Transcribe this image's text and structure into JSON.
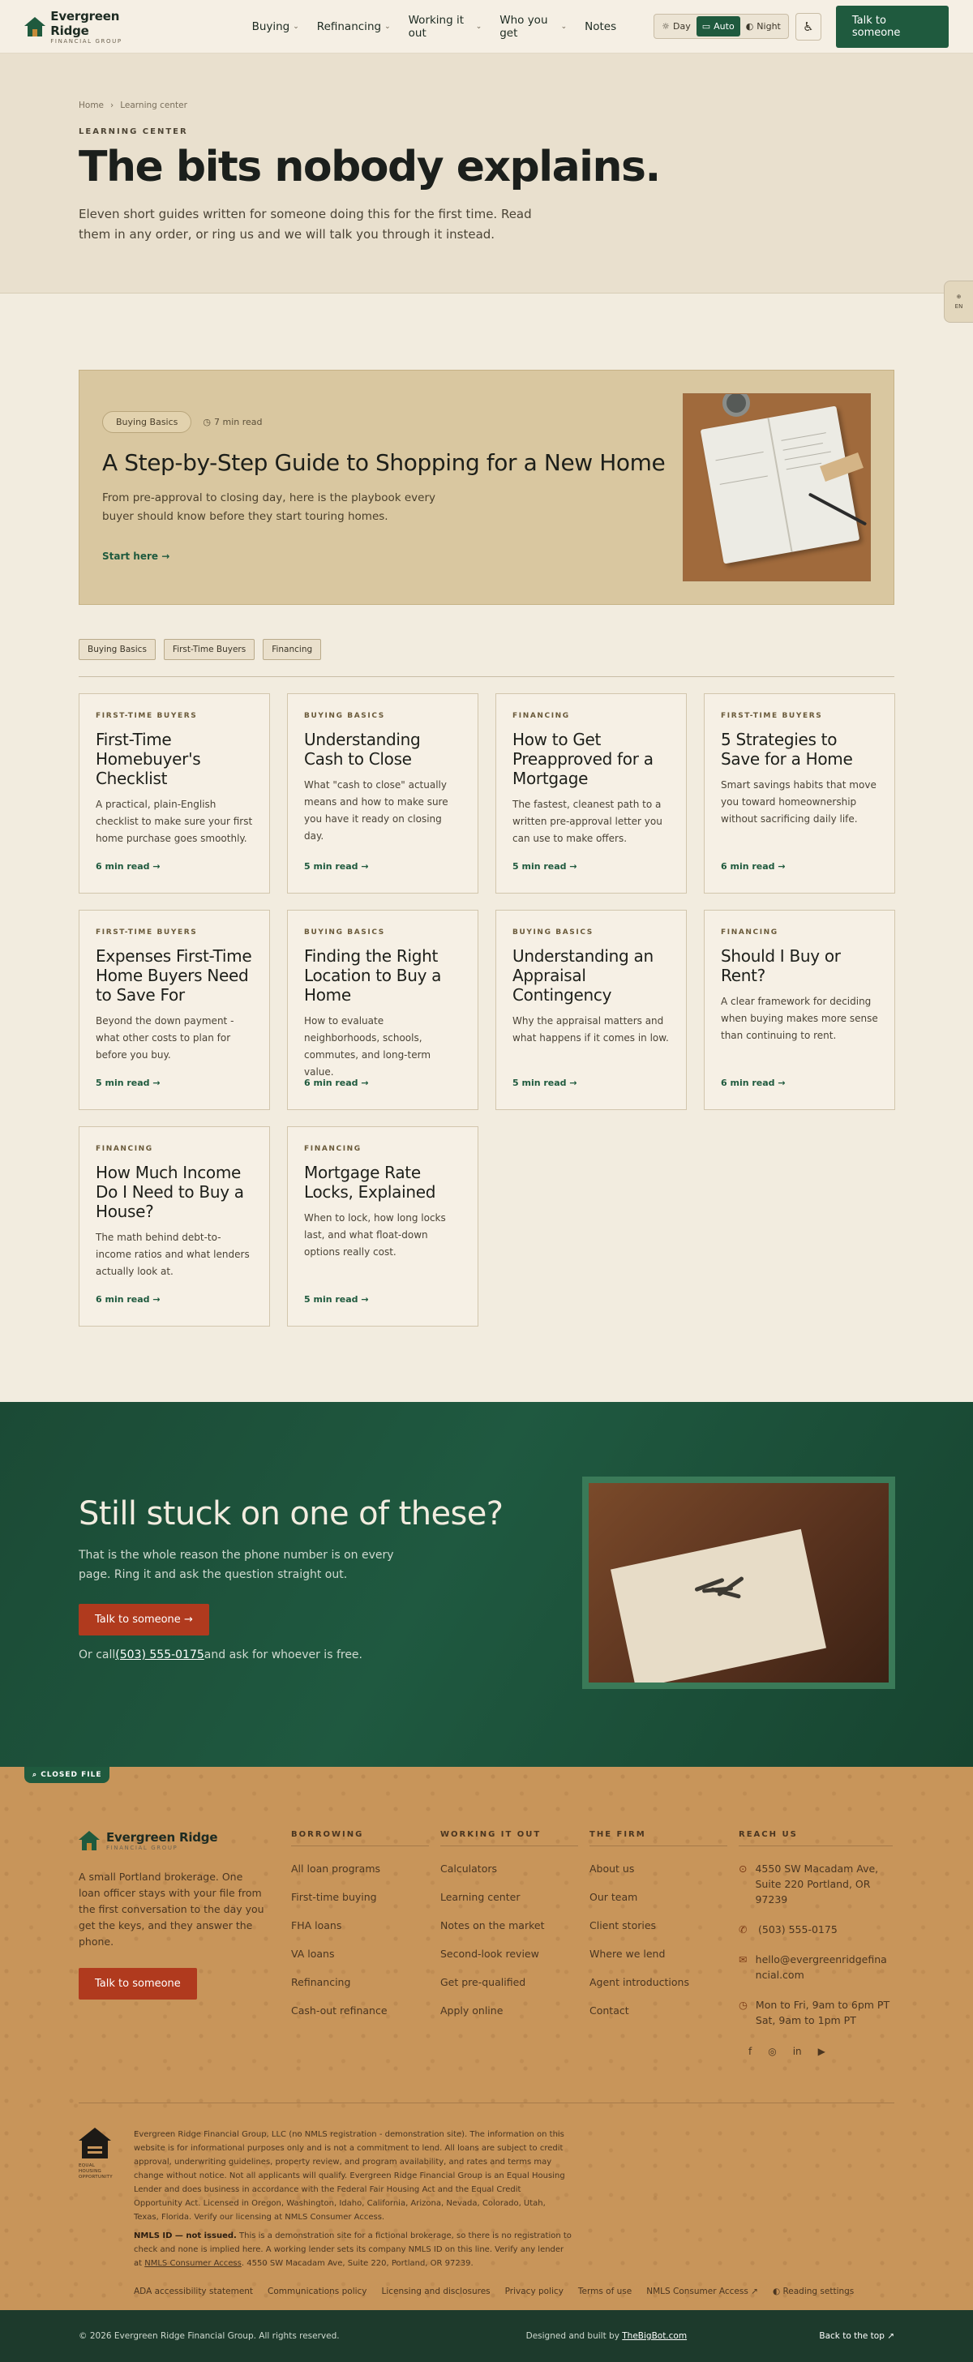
{
  "header": {
    "brand_name": "Evergreen Ridge",
    "brand_sub": "FINANCIAL GROUP",
    "nav": [
      {
        "label": "Buying",
        "has_menu": true
      },
      {
        "label": "Refinancing",
        "has_menu": true
      },
      {
        "label": "Working it out",
        "has_menu": true
      },
      {
        "label": "Who you get",
        "has_menu": true
      },
      {
        "label": "Notes",
        "has_menu": false
      }
    ],
    "theme": {
      "day": "Day",
      "auto": "Auto",
      "night": "Night",
      "selected": "Auto"
    },
    "cta": "Talk to someone"
  },
  "hero": {
    "breadcrumb": [
      "Home",
      "Learning center"
    ],
    "eyebrow": "LEARNING CENTER",
    "title": "The bits nobody explains.",
    "intro": "Eleven short guides written for someone doing this for the first time. Read them in any order, or ring us and we will talk you through it instead."
  },
  "side_tab": {
    "label": "EN"
  },
  "featured": {
    "tag": "Buying Basics",
    "read_time": "7 min read",
    "title": "A Step-by-Step Guide to Shopping for a New Home",
    "summary": "From pre-approval to closing day, here is the playbook every buyer should know before they start touring homes.",
    "link": "Start here"
  },
  "filters": [
    "Buying Basics",
    "First-Time Buyers",
    "Financing"
  ],
  "articles": [
    {
      "category": "FIRST-TIME BUYERS",
      "title": "First-Time Homebuyer's Checklist",
      "summary": "A practical, plain-English checklist to make sure your first home purchase goes smoothly.",
      "read": "6 min read"
    },
    {
      "category": "BUYING BASICS",
      "title": "Understanding Cash to Close",
      "summary": "What \"cash to close\" actually means and how to make sure you have it ready on closing day.",
      "read": "5 min read"
    },
    {
      "category": "FINANCING",
      "title": "How to Get Preapproved for a Mortgage",
      "summary": "The fastest, cleanest path to a written pre-approval letter you can use to make offers.",
      "read": "5 min read"
    },
    {
      "category": "FIRST-TIME BUYERS",
      "title": "5 Strategies to Save for a Home",
      "summary": "Smart savings habits that move you toward homeownership without sacrificing daily life.",
      "read": "6 min read"
    },
    {
      "category": "FIRST-TIME BUYERS",
      "title": "Expenses First-Time Home Buyers Need to Save For",
      "summary": "Beyond the down payment - what other costs to plan for before you buy.",
      "read": "5 min read"
    },
    {
      "category": "BUYING BASICS",
      "title": "Finding the Right Location to Buy a Home",
      "summary": "How to evaluate neighborhoods, schools, commutes, and long-term value.",
      "read": "6 min read"
    },
    {
      "category": "BUYING BASICS",
      "title": "Understanding an Appraisal Contingency",
      "summary": "Why the appraisal matters and what happens if it comes in low.",
      "read": "5 min read"
    },
    {
      "category": "FINANCING",
      "title": "Should I Buy or Rent?",
      "summary": "A clear framework for deciding when buying makes more sense than continuing to rent.",
      "read": "6 min read"
    },
    {
      "category": "FINANCING",
      "title": "How Much Income Do I Need to Buy a House?",
      "summary": "The math behind debt-to-income ratios and what lenders actually look at.",
      "read": "6 min read"
    },
    {
      "category": "FINANCING",
      "title": "Mortgage Rate Locks, Explained",
      "summary": "When to lock, how long locks last, and what float-down options really cost.",
      "read": "5 min read"
    }
  ],
  "stuck": {
    "title": "Still stuck on one of these?",
    "text": "That is the whole reason the phone number is on every page. Ring it and ask the question straight out.",
    "button": "Talk to someone",
    "call_prefix": "Or call",
    "phone": "(503) 555-0175",
    "call_suffix": "and ask for whoever is free."
  },
  "footer": {
    "closed_tag": "CLOSED FILE",
    "brand_name": "Evergreen Ridge",
    "brand_sub": "FINANCIAL GROUP",
    "blurb": "A small Portland brokerage. One loan officer stays with your file from the first conversation to the day you get the keys, and they answer the phone.",
    "button": "Talk to someone",
    "columns": [
      {
        "heading": "BORROWING",
        "links": [
          "All loan programs",
          "First-time buying",
          "FHA loans",
          "VA loans",
          "Refinancing",
          "Cash-out refinance"
        ]
      },
      {
        "heading": "WORKING IT OUT",
        "links": [
          "Calculators",
          "Learning center",
          "Notes on the market",
          "Second-look review",
          "Get pre-qualified",
          "Apply online"
        ]
      },
      {
        "heading": "THE FIRM",
        "links": [
          "About us",
          "Our team",
          "Client stories",
          "Where we lend",
          "Agent introductions",
          "Contact"
        ]
      }
    ],
    "reach": {
      "heading": "REACH US",
      "address": "4550 SW Macadam Ave, Suite 220 Portland, OR 97239",
      "phone": "(503) 555-0175",
      "email": "hello@evergreenridgefinancial.com",
      "hours": "Mon to Fri, 9am to 6pm PT Sat, 9am to 1pm PT",
      "socials": [
        "f",
        "◎",
        "in",
        "▶"
      ]
    },
    "eho_caption": "EQUAL HOUSING OPPORTUNITY",
    "legal_p1": "Evergreen Ridge Financial Group, LLC (no NMLS registration - demonstration site). The information on this website is for informational purposes only and is not a commitment to lend. All loans are subject to credit approval, underwriting guidelines, property review, and program availability, and rates and terms may change without notice. Not all applicants will qualify. Evergreen Ridge Financial Group is an Equal Housing Lender and does business in accordance with the Federal Fair Housing Act and the Equal Credit Opportunity Act. Licensed in Oregon, Washington, Idaho, California, Arizona, Nevada, Colorado, Utah, Texas, Florida. Verify our licensing at NMLS Consumer Access.",
    "legal_bold": "NMLS ID — not issued.",
    "legal_p2": "This is a demonstration site for a fictional brokerage, so there is no registration to check and none is implied here. A working lender sets its company NMLS ID on this line. Verify any lender at",
    "legal_link": "NMLS Consumer Access",
    "legal_p3": ". 4550 SW Macadam Ave, Suite 220, Portland, OR 97239.",
    "legal_links": [
      "ADA accessibility statement",
      "Communications policy",
      "Licensing and disclosures",
      "Privacy policy",
      "Terms of use",
      "NMLS Consumer Access ↗",
      "◐ Reading settings"
    ]
  },
  "bottom": {
    "copyright": "© 2026 Evergreen Ridge Financial Group. All rights reserved.",
    "built_prefix": "Designed and built by ",
    "built_by": "TheBigBot.com",
    "back_top": "Back to the top ↗"
  }
}
